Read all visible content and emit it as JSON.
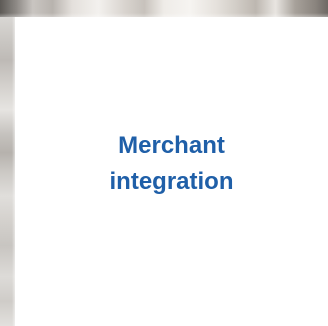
{
  "slide": {
    "title_lines": [
      "Merchant",
      "integration"
    ],
    "title_color": "#1f5fa8",
    "background_color": "#ffffff"
  }
}
